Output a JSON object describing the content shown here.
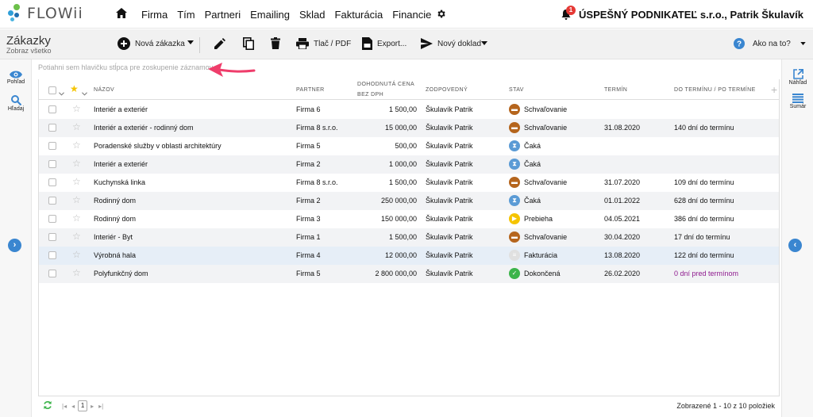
{
  "app": {
    "logo_text": "FLOWii"
  },
  "nav": {
    "menu": [
      "Firma",
      "Tím",
      "Partneri",
      "Emailing",
      "Sklad",
      "Fakturácia",
      "Financie"
    ],
    "notification_count": "1",
    "company": "ÚSPEŠNÝ PODNIKATEĽ s.r.o., Patrik Škulavík"
  },
  "toolbar": {
    "title": "Zákazky",
    "subtitle": "Zobraz všetko",
    "new_order": "Nová zákazka",
    "print": "Tlač / PDF",
    "export": "Export...",
    "new_doc": "Nový doklad",
    "help": "Ako na to?"
  },
  "left_rail": {
    "view": "Pohľad",
    "search": "Hľadaj"
  },
  "right_rail": {
    "preview": "Náhľad",
    "summary": "Sumár"
  },
  "grid": {
    "group_placeholder": "Potiahni sem hlavičku stĺpca pre zoskupenie záznamov",
    "columns": {
      "name": "NÁZOV",
      "partner": "PARTNER",
      "price_line1": "DOHODNUTÁ CENA",
      "price_line2": "BEZ DPH",
      "responsible": "ZODPOVEDNÝ",
      "status": "STAV",
      "deadline": "TERMÍN",
      "due": "DO TERMÍNU / PO TERMÍNE"
    },
    "rows": [
      {
        "name": "Interiér a exteriér",
        "partner": "Firma 6",
        "price": "1 500,00",
        "responsible": "Škulavík Patrik",
        "status": "Schvaľovanie",
        "status_icon": "approval-icon",
        "deadline": "",
        "due": ""
      },
      {
        "name": "Interiér a exteriér - rodinný dom",
        "partner": "Firma 8 s.r.o.",
        "price": "15 000,00",
        "responsible": "Škulavík Patrik",
        "status": "Schvaľovanie",
        "status_icon": "approval-icon",
        "deadline": "31.08.2020",
        "due": "140 dní do termínu"
      },
      {
        "name": "Poradenské služby v oblasti architektúry",
        "partner": "Firma 5",
        "price": "500,00",
        "responsible": "Škulavík Patrik",
        "status": "Čaká",
        "status_icon": "hourglass-icon",
        "deadline": "",
        "due": ""
      },
      {
        "name": "Interiér a exteriér",
        "partner": "Firma 2",
        "price": "1 000,00",
        "responsible": "Škulavík Patrik",
        "status": "Čaká",
        "status_icon": "hourglass-icon",
        "deadline": "",
        "due": ""
      },
      {
        "name": "Kuchynská linka",
        "partner": "Firma 8 s.r.o.",
        "price": "1 500,00",
        "responsible": "Škulavík Patrik",
        "status": "Schvaľovanie",
        "status_icon": "approval-icon",
        "deadline": "31.07.2020",
        "due": "109 dní do termínu"
      },
      {
        "name": "Rodinný dom",
        "partner": "Firma 2",
        "price": "250 000,00",
        "responsible": "Škulavík Patrik",
        "status": "Čaká",
        "status_icon": "hourglass-icon",
        "deadline": "01.01.2022",
        "due": "628 dní do termínu"
      },
      {
        "name": "Rodinný dom",
        "partner": "Firma 3",
        "price": "150 000,00",
        "responsible": "Škulavík Patrik",
        "status": "Prebieha",
        "status_icon": "play-icon",
        "deadline": "04.05.2021",
        "due": "386 dní do termínu"
      },
      {
        "name": "Interiér - Byt",
        "partner": "Firma 1",
        "price": "1 500,00",
        "responsible": "Škulavík Patrik",
        "status": "Schvaľovanie",
        "status_icon": "approval-icon",
        "deadline": "30.04.2020",
        "due": "17 dní do termínu"
      },
      {
        "name": "Výrobná hala",
        "partner": "Firma 4",
        "price": "12 000,00",
        "responsible": "Škulavík Patrik",
        "status": "Fakturácia",
        "status_icon": "invoice-icon",
        "deadline": "13.08.2020",
        "due": "122 dní do termínu"
      },
      {
        "name": "Polyfunkčný dom",
        "partner": "Firma 5",
        "price": "2 800 000,00",
        "responsible": "Škulavík Patrik",
        "status": "Dokončená",
        "status_icon": "check-icon",
        "deadline": "26.02.2020",
        "due": "0 dní pred termínom"
      }
    ]
  },
  "footer": {
    "page": "1",
    "count": "Zobrazené 1 - 10 z 10 položiek"
  },
  "colors": {
    "accent": "#3a86d0",
    "approval": "#b5651d",
    "waiting": "#5b9bd5",
    "running": "#f5c400",
    "done": "#3cb44b",
    "overdue": "#8e1a8e",
    "arrow": "#ef3d6b"
  }
}
